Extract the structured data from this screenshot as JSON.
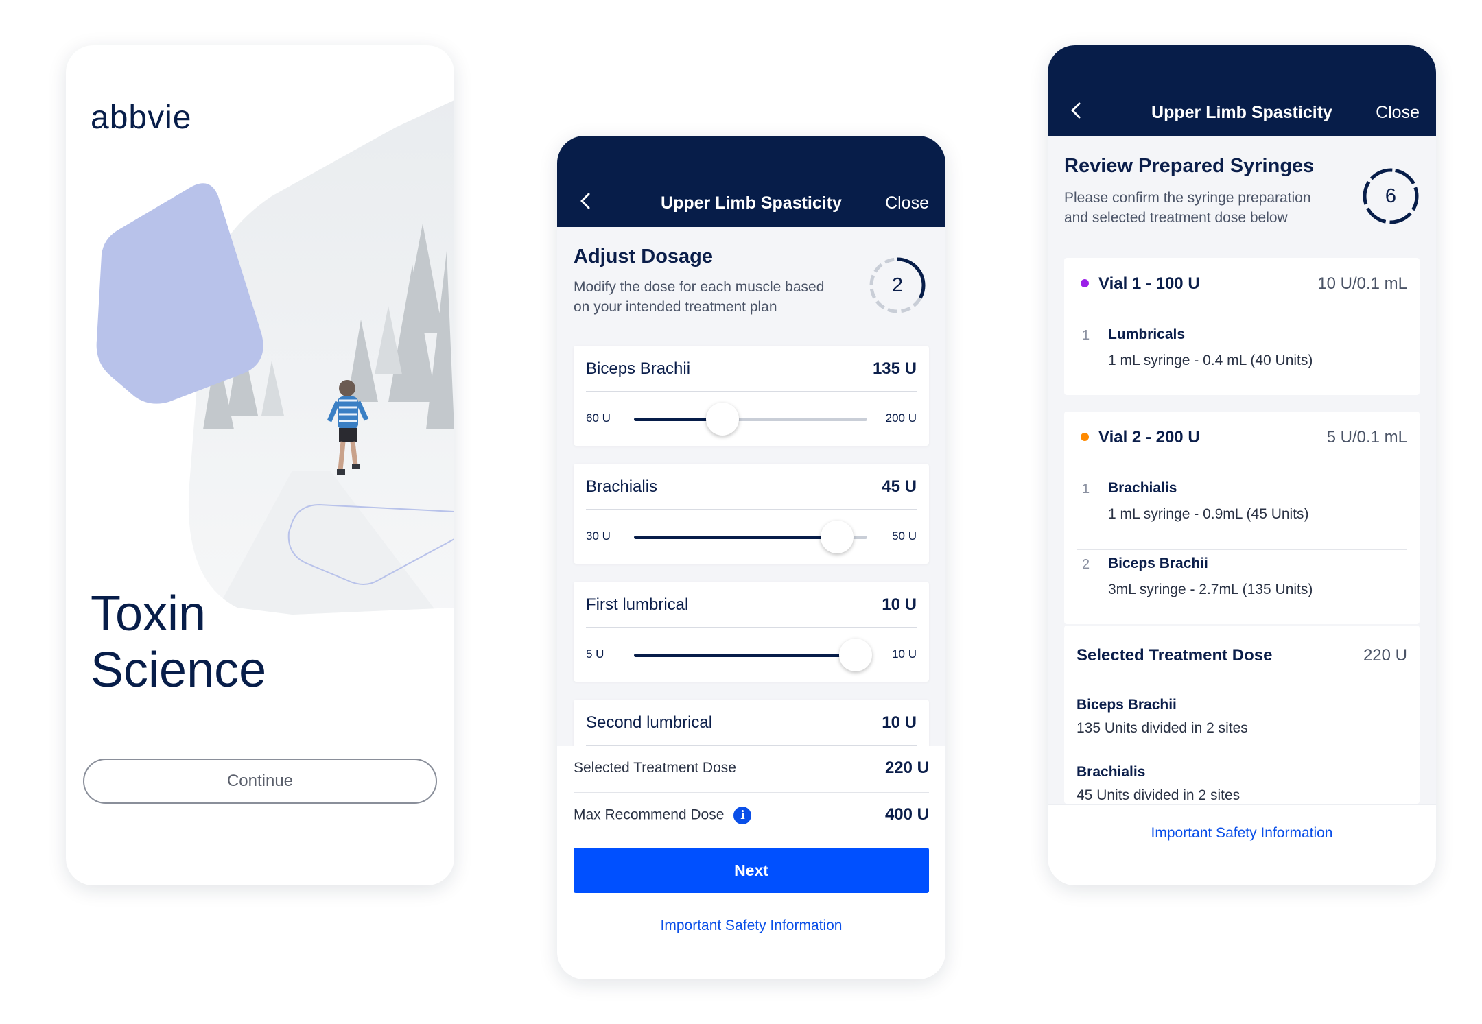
{
  "splash": {
    "logo": "abbvie",
    "title_line1": "Toxin",
    "title_line2": "Science",
    "continue_label": "Continue"
  },
  "dosage": {
    "header": {
      "title": "Upper Limb Spasticity",
      "close_label": "Close"
    },
    "section_title": "Adjust Dosage",
    "section_desc_line1": "Modify the dose for each muscle based",
    "section_desc_line2": "on your intended treatment plan",
    "step_number": "2",
    "step_progress": 0.33,
    "muscles": [
      {
        "name": "Biceps Brachii",
        "value": "135 U",
        "min": "60 U",
        "max": "200 U",
        "slider_fraction": 0.38
      },
      {
        "name": "Brachialis",
        "value": "45 U",
        "min": "30 U",
        "max": "50 U",
        "slider_fraction": 0.87
      },
      {
        "name": "First lumbrical",
        "value": "10 U",
        "min": "5 U",
        "max": "10 U",
        "slider_fraction": 0.95
      },
      {
        "name": "Second lumbrical",
        "value": "10 U"
      }
    ],
    "selected_dose_label": "Selected Treatment Dose",
    "selected_dose_value": "220 U",
    "max_dose_label": "Max Recommend Dose",
    "max_dose_value": "400 U",
    "next_label": "Next",
    "safety_link": "Important Safety Information"
  },
  "review": {
    "header": {
      "title": "Upper Limb Spasticity",
      "close_label": "Close"
    },
    "section_title": "Review Prepared Syringes",
    "section_desc_line1": "Please confirm the syringe preparation",
    "section_desc_line2": "and selected treatment dose below",
    "step_number": "6",
    "vials": [
      {
        "title": "Vial 1 - 100 U",
        "concentration": "10 U/0.1 mL",
        "dot_color": "#9b1fe8",
        "syringes": [
          {
            "index": "1",
            "muscle": "Lumbricals",
            "detail": "1 mL syringe - 0.4 mL (40 Units)"
          }
        ]
      },
      {
        "title": "Vial 2 - 200 U",
        "concentration": "5 U/0.1 mL",
        "dot_color": "#ff8a00",
        "syringes": [
          {
            "index": "1",
            "muscle": "Brachialis",
            "detail": "1 mL syringe - 0.9mL (45 Units)"
          },
          {
            "index": "2",
            "muscle": "Biceps Brachii",
            "detail": "3mL syringe - 2.7mL (135 Units)"
          }
        ]
      }
    ],
    "treatment": {
      "title": "Selected Treatment Dose",
      "value": "220 U",
      "items": [
        {
          "muscle": "Biceps Brachii",
          "detail": "135 Units divided in 2 sites"
        },
        {
          "muscle": "Brachialis",
          "detail": "45 Units divided in 2 sites"
        }
      ]
    },
    "safety_link": "Important Safety Information"
  },
  "colors": {
    "navy": "#071d49",
    "primary_blue": "#0050ff",
    "link_blue": "#0a4fe8",
    "lavender": "#b8c2ea"
  }
}
